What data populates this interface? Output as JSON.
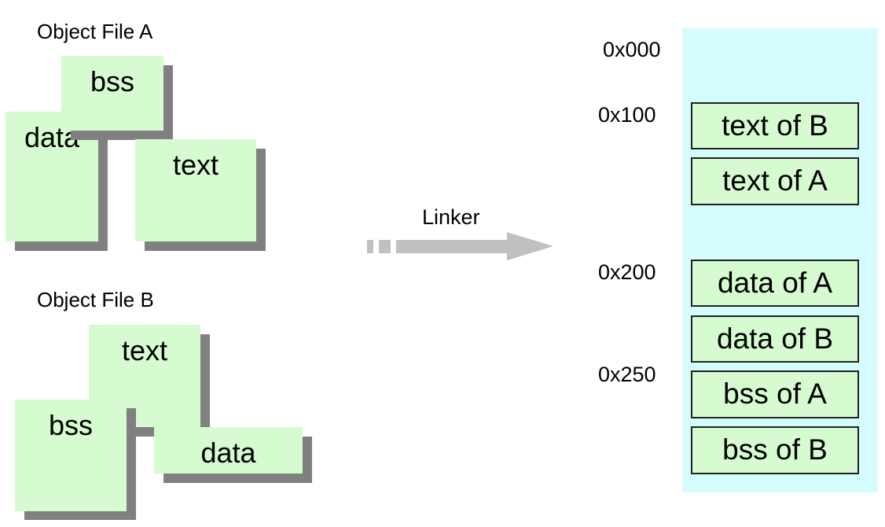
{
  "object_file_a": {
    "title": "Object File A",
    "sections": {
      "bss": "bss",
      "data": "data",
      "text": "text"
    }
  },
  "object_file_b": {
    "title": "Object File B",
    "sections": {
      "text": "text",
      "bss": "bss",
      "data": "data"
    }
  },
  "linker": {
    "label": "Linker"
  },
  "memory_map": {
    "addresses": [
      "0x000",
      "0x100",
      "0x200",
      "0x250"
    ],
    "segments": [
      "text of B",
      "text of A",
      "data of A",
      "data of B",
      "bss of A",
      "bss of B"
    ]
  },
  "colors": {
    "section_fill": "#d6fbd0",
    "shadow": "#808080",
    "memory_panel": "#d4fcfc",
    "arrow": "#c0c0c0"
  }
}
